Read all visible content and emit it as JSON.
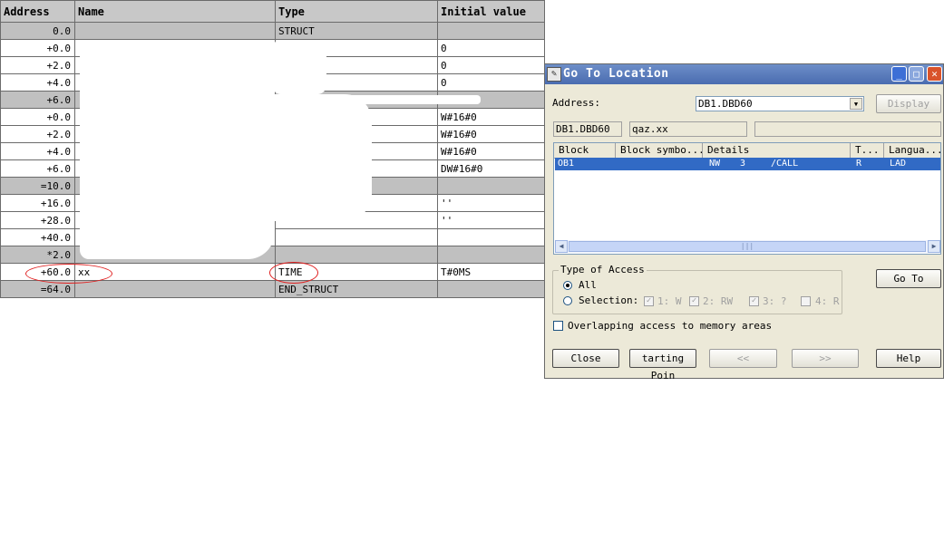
{
  "table": {
    "headers": [
      "Address",
      "Name",
      "Type",
      "Initial value"
    ],
    "rows": [
      {
        "addr": "0.0",
        "name": "",
        "type": "STRUCT",
        "init": ""
      },
      {
        "addr": "+0.0",
        "name": "",
        "type": "",
        "init": "0"
      },
      {
        "addr": "+2.0",
        "name": "",
        "type": "",
        "init": "0"
      },
      {
        "addr": "+4.0",
        "name": "",
        "type": "",
        "init": "0"
      },
      {
        "addr": "+6.0",
        "name": "",
        "type": "",
        "init": ""
      },
      {
        "addr": "+0.0",
        "name": "",
        "type": "",
        "init": "W#16#0"
      },
      {
        "addr": "+2.0",
        "name": "",
        "type": "",
        "init": "W#16#0"
      },
      {
        "addr": "+4.0",
        "name": "",
        "type": "",
        "init": "W#16#0"
      },
      {
        "addr": "+6.0",
        "name": "",
        "type": "",
        "init": "DW#16#0"
      },
      {
        "addr": "=10.0",
        "name": "",
        "type": "",
        "init": ""
      },
      {
        "addr": "+16.0",
        "name": "",
        "type": "",
        "init": "''"
      },
      {
        "addr": "+28.0",
        "name": "",
        "type": "",
        "init": "''"
      },
      {
        "addr": "+40.0",
        "name": "",
        "type": "",
        "init": ""
      },
      {
        "addr": "*2.0",
        "name": "",
        "type": "",
        "init": ""
      },
      {
        "addr": "+60.0",
        "name": "xx",
        "type": "TIME",
        "init": "T#0MS"
      },
      {
        "addr": "=64.0",
        "name": "",
        "type": "END_STRUCT",
        "init": ""
      }
    ]
  },
  "dialog": {
    "title": "Go To Location",
    "address_label": "Address:",
    "address_value": "DB1.DBD60",
    "display_button": "Display",
    "ro_address": "DB1.DBD60",
    "ro_symbol": "qaz.xx",
    "ro_extra": "",
    "list": {
      "headers": [
        "Block",
        "Block symbo...",
        "Details",
        "T...",
        "Langua..."
      ],
      "rows": [
        {
          "block": "OB1",
          "symbol": "",
          "details_a": "NW",
          "details_b": "3",
          "details_c": "/CALL",
          "type": "R",
          "lang": "LAD"
        }
      ]
    },
    "access_group_title": "Type of Access",
    "radio_all": "All",
    "radio_selection": "Selection:",
    "checks": [
      "1: W",
      "2: RW",
      "3: ?",
      "4: R"
    ],
    "overlap_label": "Overlapping access to memory areas",
    "goto_button": "Go To",
    "buttons": {
      "close": "Close",
      "starting_point": "tarting Poin",
      "prev": "<<",
      "next": ">>",
      "help": "Help"
    }
  }
}
